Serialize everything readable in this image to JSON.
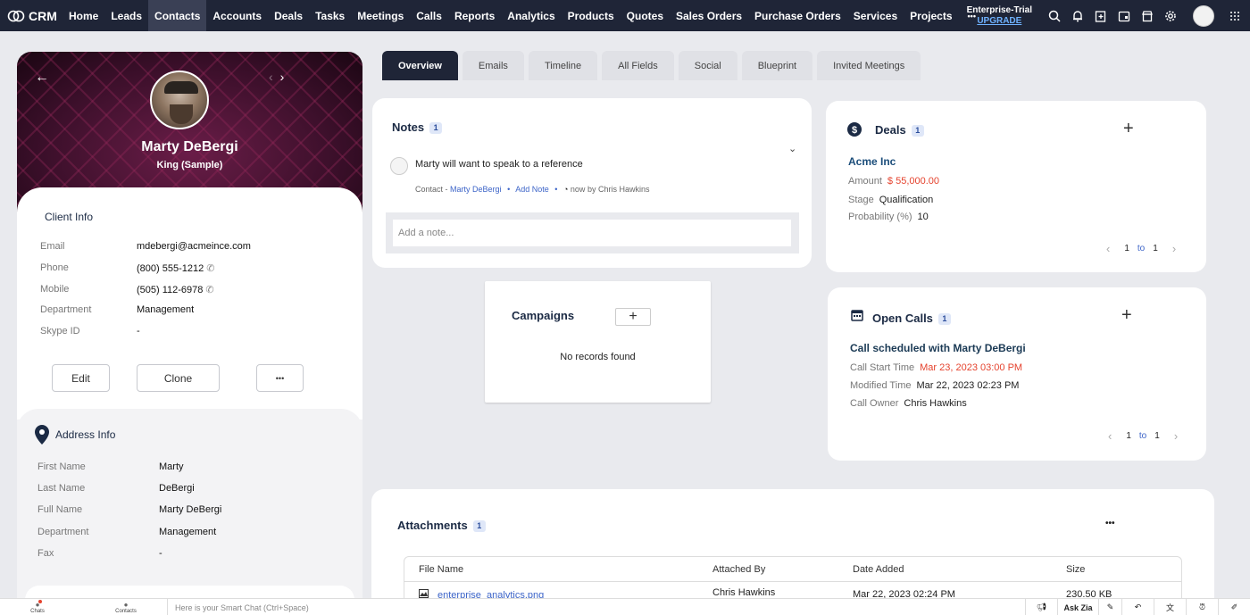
{
  "app": {
    "name": "CRM"
  },
  "nav": {
    "items": [
      "Home",
      "Leads",
      "Contacts",
      "Accounts",
      "Deals",
      "Tasks",
      "Meetings",
      "Calls",
      "Reports",
      "Analytics",
      "Products",
      "Quotes",
      "Sales Orders",
      "Purchase Orders",
      "Services",
      "Projects"
    ],
    "active": "Contacts",
    "more": "•••",
    "edition": "Enterprise-Trial",
    "upgrade": "UPGRADE"
  },
  "profile": {
    "name": "Marty DeBergi",
    "title": "King (Sample)",
    "back": "←",
    "prev": "‹",
    "next": "›"
  },
  "client_info": {
    "title": "Client Info",
    "fields": [
      {
        "label": "Email",
        "value": "mdebergi@acmeince.com"
      },
      {
        "label": "Phone",
        "value": "(800) 555-1212"
      },
      {
        "label": "Mobile",
        "value": "(505) 112-6978"
      },
      {
        "label": "Department",
        "value": "Management"
      },
      {
        "label": "Skype ID",
        "value": "-"
      }
    ],
    "edit": "Edit",
    "clone": "Clone",
    "more": "•••"
  },
  "address_info": {
    "title": "Address Info",
    "fields": [
      {
        "label": "First Name",
        "value": "Marty"
      },
      {
        "label": "Last Name",
        "value": "DeBergi"
      },
      {
        "label": "Full Name",
        "value": "Marty DeBergi"
      },
      {
        "label": "Department",
        "value": "Management"
      },
      {
        "label": "Fax",
        "value": "-"
      }
    ]
  },
  "tabs": [
    "Overview",
    "Emails",
    "Timeline",
    "All Fields",
    "Social",
    "Blueprint",
    "Invited Meetings"
  ],
  "notes": {
    "title": "Notes",
    "count": "1",
    "text": "Marty will want to speak to a reference",
    "meta_prefix": "Contact -",
    "meta_contact": "Marty DeBergi",
    "meta_add": "Add Note",
    "meta_time": "now",
    "meta_by": "by",
    "meta_author": "Chris Hawkins",
    "placeholder": "Add a note..."
  },
  "campaigns": {
    "title": "Campaigns",
    "empty": "No records found",
    "plus": "+"
  },
  "deals": {
    "title": "Deals",
    "count": "1",
    "name": "Acme Inc",
    "amount_label": "Amount",
    "amount": "$ 55,000.00",
    "stage_label": "Stage",
    "stage": "Qualification",
    "prob_label": "Probability (%)",
    "prob": "10",
    "page_from": "1",
    "page_to_word": "to",
    "page_to": "1",
    "plus": "+"
  },
  "calls": {
    "title": "Open Calls",
    "count": "1",
    "subject": "Call scheduled with Marty DeBergi",
    "start_label": "Call Start Time",
    "start": "Mar 23, 2023 03:00 PM",
    "modified_label": "Modified Time",
    "modified": "Mar 22, 2023 02:23 PM",
    "owner_label": "Call Owner",
    "owner": "Chris Hawkins",
    "page_from": "1",
    "page_to_word": "to",
    "page_to": "1",
    "plus": "+"
  },
  "attachments": {
    "title": "Attachments",
    "count": "1",
    "more": "•••",
    "columns": [
      "File Name",
      "Attached By",
      "Date Added",
      "Size"
    ],
    "rows": [
      {
        "file": "enterprise_analytics.png",
        "by": "Chris Hawkins",
        "date": "Mar 22, 2023 02:24 PM",
        "size": "230.50 KB"
      }
    ]
  },
  "bottombar": {
    "chats": "Chats",
    "contacts": "Contacts",
    "smartchat": "Here is your Smart Chat (Ctrl+Space)",
    "ask_zia": "Ask Zia"
  },
  "colors": {
    "accent": "#1f2537",
    "link": "#3c64c8",
    "alert": "#e5432e"
  }
}
